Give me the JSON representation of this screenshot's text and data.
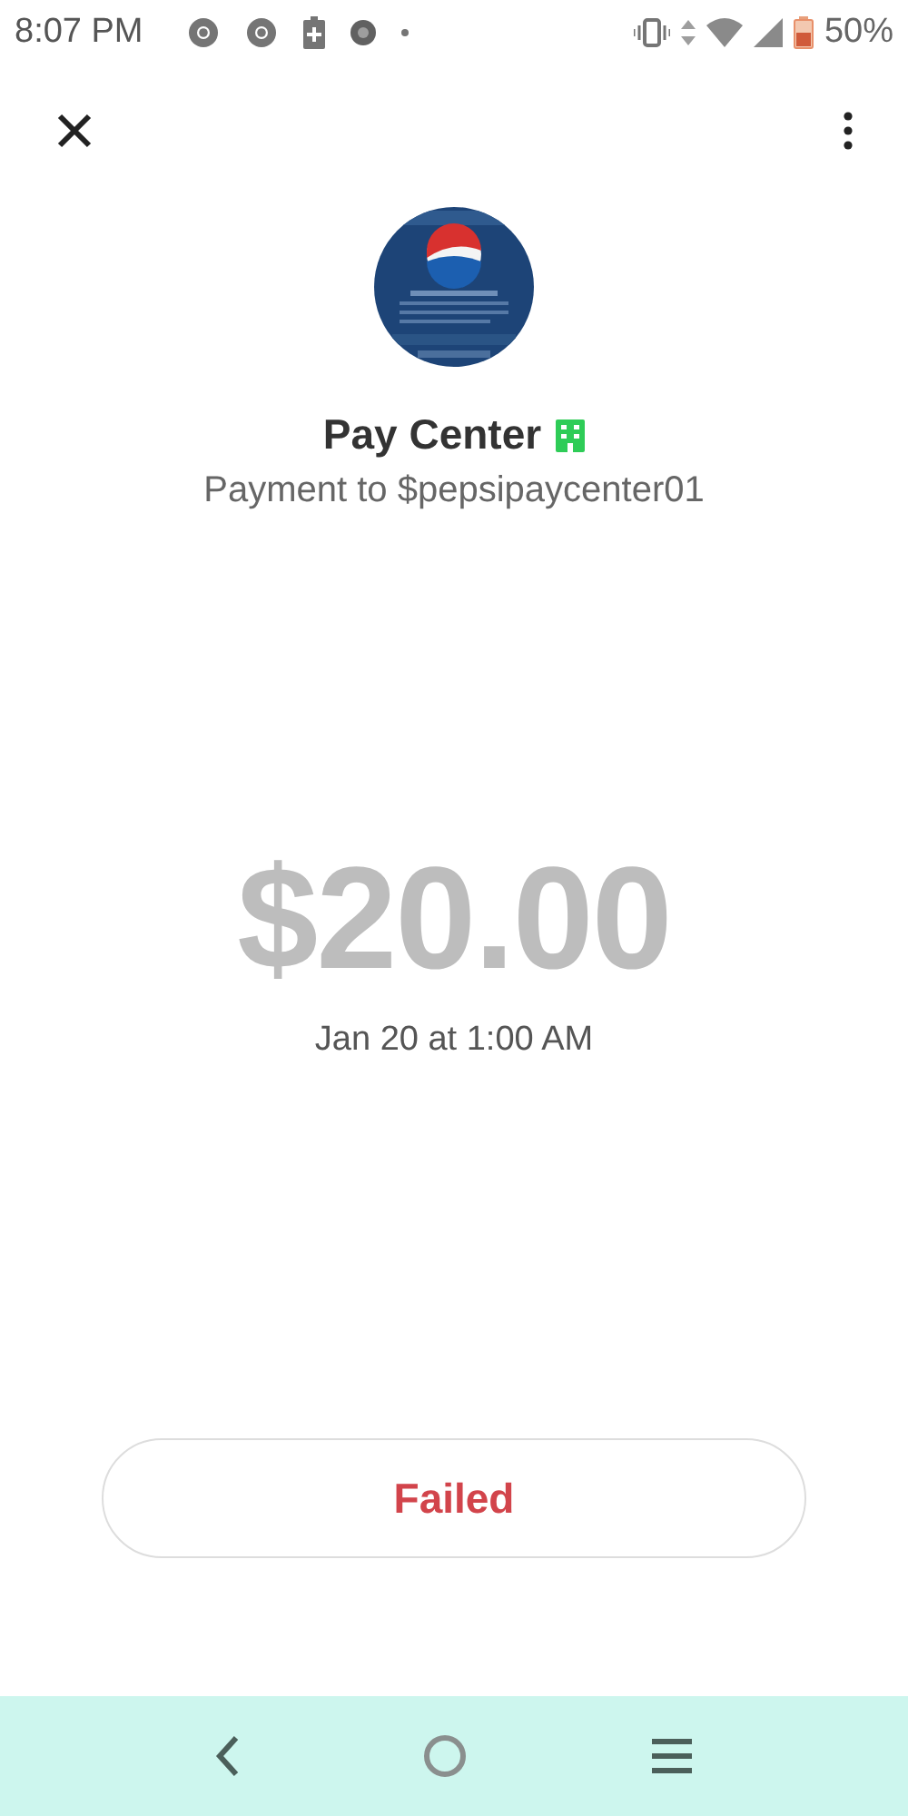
{
  "status_bar": {
    "time": "8:07 PM",
    "battery": "50%"
  },
  "recipient": {
    "name": "Pay Center",
    "verified_business": true,
    "subtitle": "Payment to $pepsipaycenter01"
  },
  "payment": {
    "amount": "$20.00",
    "date": "Jan 20 at 1:00 AM",
    "status": "Failed"
  }
}
